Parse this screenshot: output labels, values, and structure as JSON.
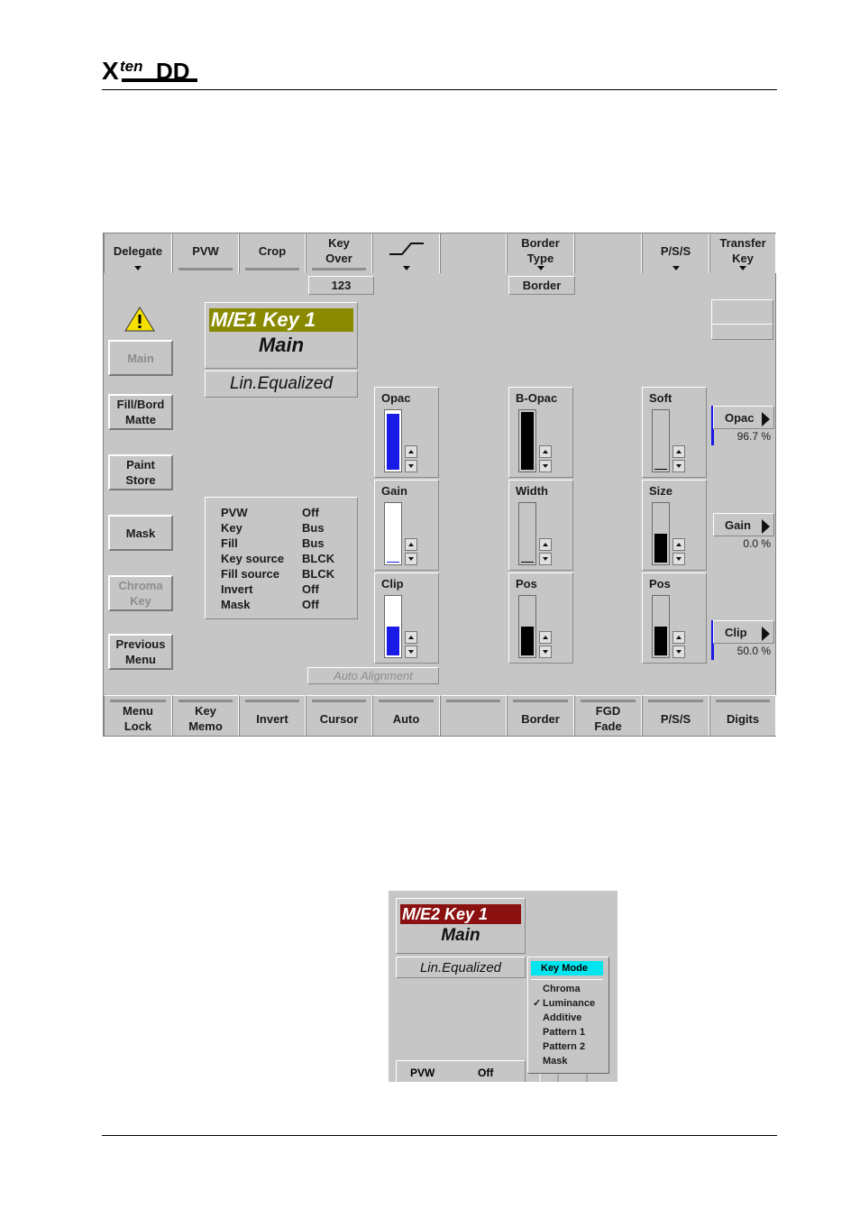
{
  "header": {
    "logo_text": "Xten DD"
  },
  "top_buttons": [
    {
      "label": "Delegate",
      "has_arrow": true
    },
    {
      "label": "PVW",
      "has_bar": true
    },
    {
      "label": "Crop",
      "has_bar": true
    },
    {
      "label": "Key\nOver",
      "has_bar": true
    },
    {
      "label": "",
      "icon": "ramp-icon",
      "has_arrow": true
    },
    {
      "label": ""
    },
    {
      "label": "Border\nType",
      "has_arrow": true
    },
    {
      "label": ""
    },
    {
      "label": "P/S/S",
      "has_arrow": true
    },
    {
      "label": "Transfer\nKey",
      "has_arrow": true
    }
  ],
  "sub_boxes": {
    "key_over_value": "123",
    "border_type_value": "Border"
  },
  "side_buttons": [
    {
      "label": "Main",
      "enabled": false
    },
    {
      "label": "Fill/Bord\nMatte",
      "enabled": true
    },
    {
      "label": "Paint\nStore",
      "enabled": true
    },
    {
      "label": "Mask",
      "enabled": true
    },
    {
      "label": "Chroma\nKey",
      "enabled": false
    },
    {
      "label": "Previous\nMenu",
      "enabled": true
    }
  ],
  "key_title": {
    "name": "M/E1 Key 1",
    "sub": "Main",
    "mode": "Lin.Equalized"
  },
  "status": {
    "rows": [
      {
        "k": "PVW",
        "v": "Off"
      },
      {
        "k": "Key",
        "v": "Bus"
      },
      {
        "k": "Fill",
        "v": "Bus"
      },
      {
        "k": "Key source",
        "v": "BLCK"
      },
      {
        "k": "Fill source",
        "v": "BLCK"
      },
      {
        "k": "Invert",
        "v": "Off"
      },
      {
        "k": "Mask",
        "v": "Off"
      }
    ]
  },
  "sliders": {
    "opac": {
      "label": "Opac",
      "level": 0.967
    },
    "gain": {
      "label": "Gain",
      "level": 0.0
    },
    "clip": {
      "label": "Clip",
      "level": 0.5
    },
    "b_opac": {
      "label": "B-Opac",
      "level": 1.0
    },
    "width": {
      "label": "Width",
      "level": 0.0
    },
    "border_pos": {
      "label": "Pos",
      "level": 0.5
    },
    "soft": {
      "label": "Soft",
      "level": 0.0
    },
    "size": {
      "label": "Size",
      "level": 0.5
    },
    "pss_pos": {
      "label": "Pos",
      "level": 0.5
    }
  },
  "value_buttons": [
    {
      "label": "Opac",
      "value": "96.7 %"
    },
    {
      "label": "Gain",
      "value": "0.0 %"
    },
    {
      "label": "Clip",
      "value": "50.0 %"
    }
  ],
  "auto_alignment": "Auto Alignment",
  "bottom_buttons": [
    "Menu\nLock",
    "Key\nMemo",
    "Invert",
    "Cursor",
    "Auto",
    "",
    "Border",
    "FGD\nFade",
    "P/S/S",
    "Digits"
  ],
  "dropdown_view": {
    "key_title": {
      "name": "M/E2 Key 1",
      "sub": "Main",
      "mode": "Lin.Equalized"
    },
    "menu": {
      "header": "Key Mode",
      "items": [
        "Chroma",
        "Luminance",
        "Additive",
        "Pattern 1",
        "Pattern 2",
        "Mask"
      ],
      "checked": "Luminance"
    },
    "status_row": {
      "k": "PVW",
      "v": "Off"
    }
  },
  "colors": {
    "panel": "#c6c6c6",
    "key1_title": "#8a8a00",
    "key2_title": "#8b1010",
    "slider_blue": "#1a1ae6",
    "menu_header": "#00e5ee"
  }
}
